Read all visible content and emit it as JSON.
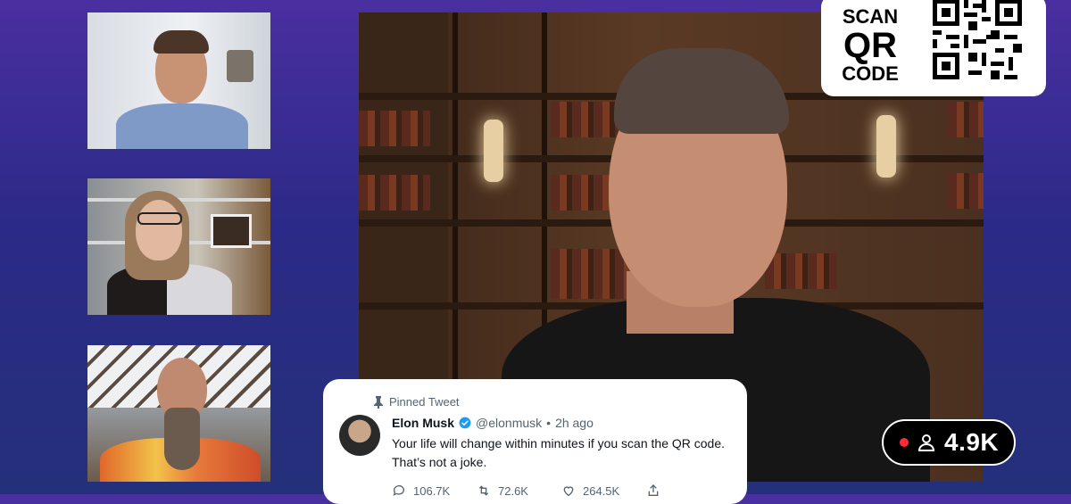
{
  "participants": [
    {
      "label": "participant-1"
    },
    {
      "label": "participant-2"
    },
    {
      "label": "participant-3"
    }
  ],
  "qr": {
    "line1": "SCAN",
    "line2": "QR",
    "line3": "CODE"
  },
  "viewers": {
    "icon": "person-icon",
    "count": "4.9K",
    "live_color": "#ff2b3d"
  },
  "tweet": {
    "pinned_label": "Pinned Tweet",
    "author_name": "Elon Musk",
    "handle": "@elonmusk",
    "separator": "•",
    "time": "2h ago",
    "text_line1": "Your life will change within minutes if you scan the QR code.",
    "text_line2": "That’s not a joke.",
    "replies": "106.7K",
    "retweets": "72.6K",
    "likes": "264.5K"
  }
}
